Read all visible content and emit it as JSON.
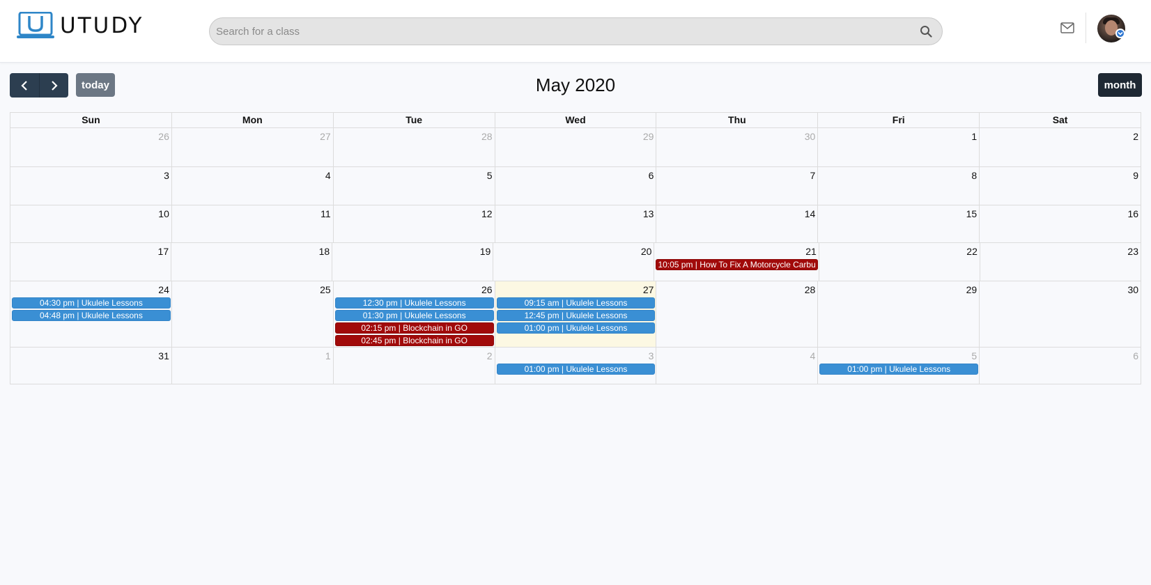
{
  "header": {
    "logo_text": "UTUDY",
    "search_placeholder": "Search for a class"
  },
  "toolbar": {
    "prev_icon": "chevron-left-icon",
    "next_icon": "chevron-right-icon",
    "today_label": "today",
    "title": "May 2020",
    "month_label": "month"
  },
  "weekdays": [
    "Sun",
    "Mon",
    "Tue",
    "Wed",
    "Thu",
    "Fri",
    "Sat"
  ],
  "colors": {
    "event_blue": "#3a8fd4",
    "event_red": "#a10a0a",
    "today_bg": "#fcf8e3",
    "nav_button": "#2c3e50"
  },
  "weeks": [
    {
      "days": [
        {
          "num": "26",
          "other": true,
          "events": []
        },
        {
          "num": "27",
          "other": true,
          "events": []
        },
        {
          "num": "28",
          "other": true,
          "events": []
        },
        {
          "num": "29",
          "other": true,
          "events": []
        },
        {
          "num": "30",
          "other": true,
          "events": []
        },
        {
          "num": "1",
          "events": []
        },
        {
          "num": "2",
          "events": []
        }
      ]
    },
    {
      "days": [
        {
          "num": "3",
          "events": []
        },
        {
          "num": "4",
          "events": []
        },
        {
          "num": "5",
          "events": []
        },
        {
          "num": "6",
          "events": []
        },
        {
          "num": "7",
          "events": []
        },
        {
          "num": "8",
          "events": []
        },
        {
          "num": "9",
          "events": []
        }
      ]
    },
    {
      "days": [
        {
          "num": "10",
          "events": []
        },
        {
          "num": "11",
          "events": []
        },
        {
          "num": "12",
          "events": []
        },
        {
          "num": "13",
          "events": []
        },
        {
          "num": "14",
          "events": []
        },
        {
          "num": "15",
          "events": []
        },
        {
          "num": "16",
          "events": []
        }
      ]
    },
    {
      "days": [
        {
          "num": "17",
          "events": []
        },
        {
          "num": "18",
          "events": []
        },
        {
          "num": "19",
          "events": []
        },
        {
          "num": "20",
          "events": []
        },
        {
          "num": "21",
          "events": [
            {
              "label": "10:05 pm | How To Fix A Motorcycle Carbu",
              "color": "red"
            }
          ]
        },
        {
          "num": "22",
          "events": []
        },
        {
          "num": "23",
          "events": []
        }
      ]
    },
    {
      "days": [
        {
          "num": "24",
          "events": [
            {
              "label": "04:30 pm | Ukulele Lessons",
              "color": "blue"
            },
            {
              "label": "04:48 pm | Ukulele Lessons",
              "color": "blue"
            }
          ]
        },
        {
          "num": "25",
          "events": []
        },
        {
          "num": "26",
          "events": [
            {
              "label": "12:30 pm | Ukulele Lessons",
              "color": "blue"
            },
            {
              "label": "01:30 pm | Ukulele Lessons",
              "color": "blue"
            },
            {
              "label": "02:15 pm | Blockchain in GO",
              "color": "red center"
            },
            {
              "label": "02:45 pm | Blockchain in GO",
              "color": "red center"
            }
          ]
        },
        {
          "num": "27",
          "today": true,
          "events": [
            {
              "label": "09:15 am | Ukulele Lessons",
              "color": "blue"
            },
            {
              "label": "12:45 pm | Ukulele Lessons",
              "color": "blue"
            },
            {
              "label": "01:00 pm | Ukulele Lessons",
              "color": "blue"
            }
          ]
        },
        {
          "num": "28",
          "events": []
        },
        {
          "num": "29",
          "events": []
        },
        {
          "num": "30",
          "events": []
        }
      ]
    },
    {
      "days": [
        {
          "num": "31",
          "events": []
        },
        {
          "num": "1",
          "other": true,
          "events": []
        },
        {
          "num": "2",
          "other": true,
          "events": []
        },
        {
          "num": "3",
          "other": true,
          "events": [
            {
              "label": "01:00 pm | Ukulele Lessons",
              "color": "blue"
            }
          ]
        },
        {
          "num": "4",
          "other": true,
          "events": []
        },
        {
          "num": "5",
          "other": true,
          "events": [
            {
              "label": "01:00 pm | Ukulele Lessons",
              "color": "blue"
            }
          ]
        },
        {
          "num": "6",
          "other": true,
          "events": []
        }
      ]
    }
  ]
}
